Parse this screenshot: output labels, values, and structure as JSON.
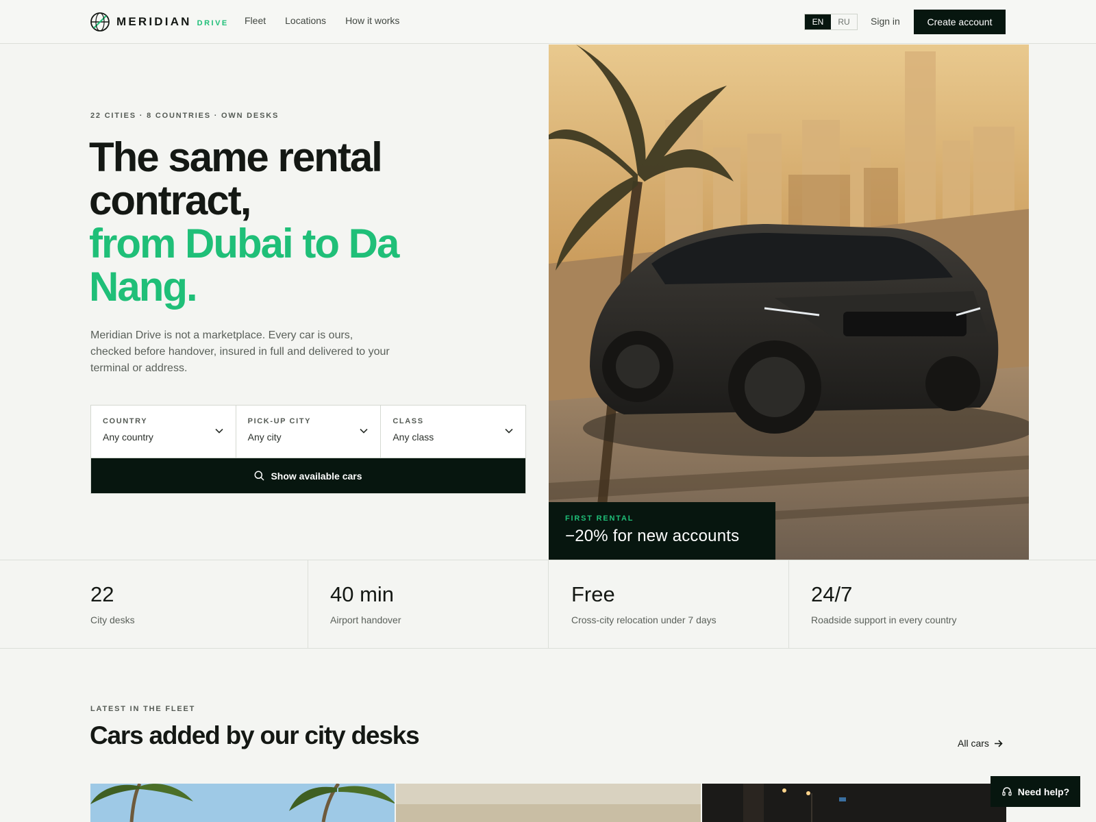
{
  "brand": {
    "name": "MERIDIAN",
    "sub": "DRIVE",
    "accent": "#1fbf78",
    "dark": "#07160f"
  },
  "nav": {
    "items": [
      "Fleet",
      "Locations",
      "How it works"
    ]
  },
  "language": {
    "options": [
      "EN",
      "RU"
    ],
    "active": "EN"
  },
  "auth": {
    "signin": "Sign in",
    "create": "Create account"
  },
  "hero": {
    "eyebrow": "22 CITIES · 8 COUNTRIES · OWN DESKS",
    "headline_line1": "The same rental",
    "headline_line2": "contract,",
    "headline_green1": "from Dubai to Da",
    "headline_green2": "Nang.",
    "lede": "Meridian Drive is not a marketplace. Every car is ours, checked before handover, insured in full and delivered to your terminal or address."
  },
  "search": {
    "fields": [
      {
        "label": "COUNTRY",
        "value": "Any country"
      },
      {
        "label": "PICK-UP CITY",
        "value": "Any city"
      },
      {
        "label": "CLASS",
        "value": "Any class"
      }
    ],
    "button": "Show available cars"
  },
  "promo": {
    "label": "FIRST RENTAL",
    "text": "−20% for new accounts"
  },
  "stats": [
    {
      "value": "22",
      "label": "City desks"
    },
    {
      "value": "40 min",
      "label": "Airport handover"
    },
    {
      "value": "Free",
      "label": "Cross-city relocation under 7 days"
    },
    {
      "value": "24/7",
      "label": "Roadside support in every country"
    }
  ],
  "fleet": {
    "eyebrow": "LATEST IN THE FLEET",
    "title": "Cars added by our city desks",
    "all_cars": "All cars"
  },
  "help": {
    "label": "Need help?"
  },
  "icons": {
    "logo": "globe-icon",
    "chevron": "chevron-down-icon",
    "search": "search-icon",
    "arrow": "arrow-right-icon",
    "headset": "headset-icon"
  }
}
